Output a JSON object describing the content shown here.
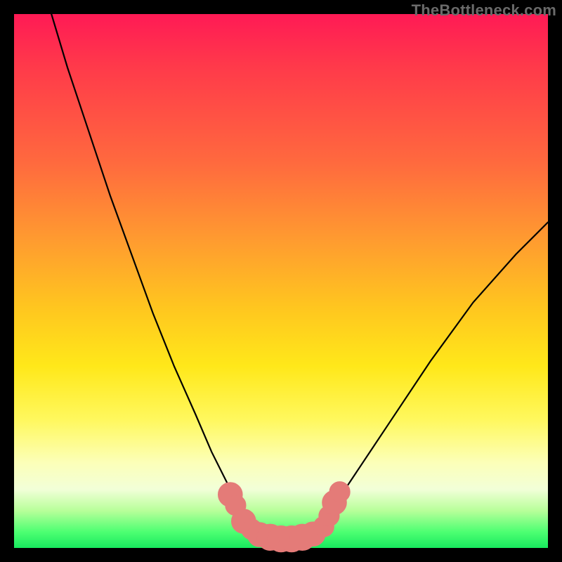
{
  "watermark": "TheBottleneck.com",
  "colors": {
    "frame": "#000000",
    "gradient_top": "#ff1a55",
    "gradient_bottom": "#18e95e",
    "curve": "#000000",
    "marker": "#e47b78"
  },
  "chart_data": {
    "type": "line",
    "title": "",
    "xlabel": "",
    "ylabel": "",
    "xlim": [
      0,
      100
    ],
    "ylim": [
      0,
      100
    ],
    "grid": false,
    "legend": false,
    "notes": "Single V-shaped curve on a rainbow gradient; minimum region highlighted with salmon markers near the bottom. Axes unlabeled. Values estimated by pixel position.",
    "series": [
      {
        "name": "curve",
        "x": [
          7,
          10,
          14,
          18,
          22,
          26,
          30,
          34,
          37,
          40,
          42,
          44,
          46,
          48,
          50,
          52,
          54,
          56,
          58,
          60,
          64,
          70,
          78,
          86,
          94,
          100
        ],
        "y": [
          100,
          90,
          78,
          66,
          55,
          44,
          34,
          25,
          18,
          12,
          8,
          5,
          3,
          2,
          1.5,
          1.5,
          2,
          3,
          5,
          8,
          14,
          23,
          35,
          46,
          55,
          61
        ]
      }
    ],
    "markers": [
      {
        "x": 40.5,
        "y": 10,
        "r": 1.8
      },
      {
        "x": 41.5,
        "y": 8,
        "r": 1.4
      },
      {
        "x": 43,
        "y": 5,
        "r": 1.8
      },
      {
        "x": 44.5,
        "y": 3.5,
        "r": 1.4
      },
      {
        "x": 46,
        "y": 2.5,
        "r": 1.8
      },
      {
        "x": 48,
        "y": 2,
        "r": 2.0
      },
      {
        "x": 50,
        "y": 1.7,
        "r": 2.0
      },
      {
        "x": 52,
        "y": 1.7,
        "r": 2.0
      },
      {
        "x": 54,
        "y": 2,
        "r": 2.0
      },
      {
        "x": 56,
        "y": 2.6,
        "r": 1.8
      },
      {
        "x": 58,
        "y": 4,
        "r": 1.4
      },
      {
        "x": 59,
        "y": 6,
        "r": 1.4
      },
      {
        "x": 60,
        "y": 8.5,
        "r": 1.8
      },
      {
        "x": 61,
        "y": 10.5,
        "r": 1.4
      }
    ]
  }
}
